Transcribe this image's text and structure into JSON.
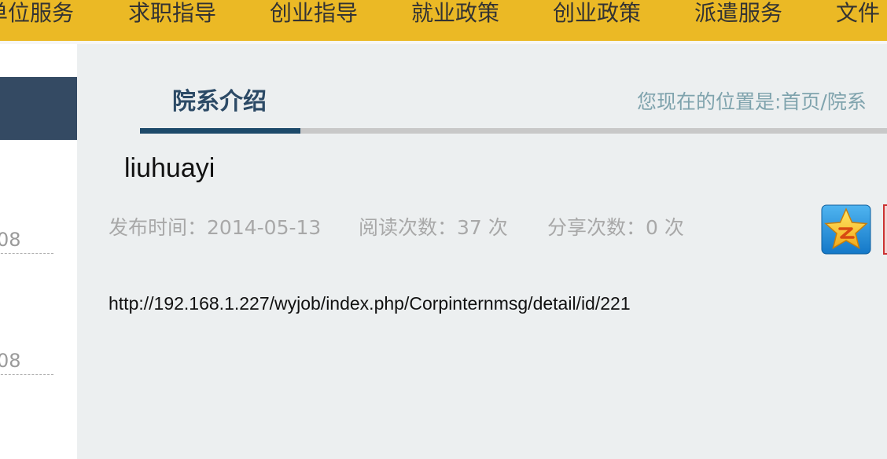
{
  "nav": {
    "items": [
      "单位服务",
      "求职指导",
      "创业指导",
      "就业政策",
      "创业政策",
      "派遣服务",
      "文件"
    ]
  },
  "sidebar": {
    "entries": [
      "08",
      "08"
    ]
  },
  "section": {
    "title": "院系介绍",
    "breadcrumb": "您现在的位置是:首页/院系"
  },
  "article": {
    "title": "liuhuayi",
    "publish_label": "发布时间：",
    "publish_date": "2014-05-13",
    "read_label": "阅读次数：",
    "read_count": "37",
    "read_unit": "次",
    "share_label": "分享次数：",
    "share_count": "0",
    "share_unit": "次",
    "body": "http://192.168.1.227/wyjob/index.php/Corpinternmsg/detail/id/221"
  },
  "share_buttons": {
    "icons": [
      "qzone-star-icon",
      "weibo-icon"
    ]
  },
  "colors": {
    "nav_bg": "#ebb925",
    "sidebar_head": "#344a63",
    "tab_active": "#1d4a6a",
    "page_bg": "#eceff0"
  }
}
